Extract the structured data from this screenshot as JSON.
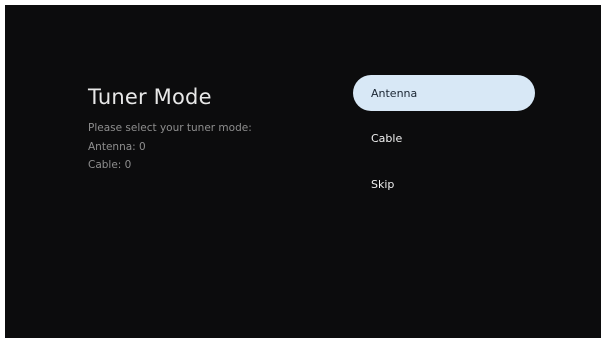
{
  "page": {
    "title": "Tuner Mode",
    "description": "Please select your tuner mode:",
    "antenna_count": "Antenna: 0",
    "cable_count": "Cable: 0"
  },
  "options": [
    {
      "label": "Antenna",
      "focused": true
    },
    {
      "label": "Cable",
      "focused": false
    },
    {
      "label": "Skip",
      "focused": false
    }
  ],
  "colors": {
    "background": "#0c0c0d",
    "focus_highlight": "#d8e8f6"
  }
}
